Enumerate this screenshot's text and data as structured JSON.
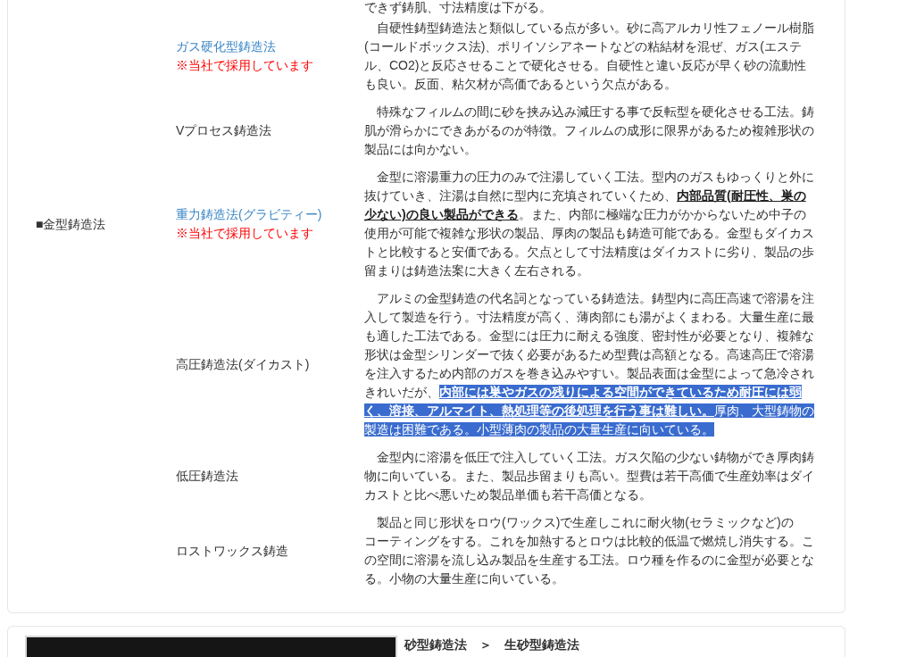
{
  "table": {
    "rows": [
      {
        "kind": "continuation",
        "description": [
          {
            "text": "できず鋳肌、寸法精度は下がる。",
            "selected": false
          }
        ]
      },
      {
        "kind": "method",
        "name": "ガス硬化型鋳造法",
        "linked": true,
        "note": "※当社で採用しています",
        "description": [
          {
            "text": "自硬性鋳型鋳造法と類似している点が多い。砂に高アルカリ性フェノール樹脂(コールドボックス法)、ポリイソシアネートなどの粘結材を混ぜ、ガス(エステル、CO2)と反応させることで硬化させる。自硬性と違い反応が早く砂の流動性も良い。反面、粘欠材が高価であるという欠点がある。",
            "selected": false
          }
        ]
      },
      {
        "kind": "method",
        "name": "Vプロセス鋳造法",
        "linked": false,
        "description": [
          {
            "text": "特殊なフィルムの間に砂を挟み込み減圧する事で反転型を硬化させる工法。鋳肌が滑らかにできあがるのが特徴。フィルムの成形に限界があるため複雑形状の製品には向かない。",
            "selected": false
          }
        ]
      },
      {
        "kind": "method",
        "category": "■金型鋳造法",
        "name": "重力鋳造法(グラビティー)",
        "linked": true,
        "note": "※当社で採用しています",
        "description": [
          {
            "text": "金型に溶湯重力の圧力のみで注湯していく工法。型内のガスもゆっくりと外に抜けていき、注湯は自然に型内に充填されていくため、**内部品質(耐圧性、巣の少ない)の良い製品ができる**。また、内部に極端な圧力がかからないため中子の使用が可能で複雑な形状の製品、厚肉の製品も鋳造可能である。金型もダイカストと比較すると安価である。欠点として寸法精度はダイカストに劣り、製品の歩留まりは鋳造法案に大きく左右される。",
            "selected": false
          }
        ]
      },
      {
        "kind": "method",
        "name": "高圧鋳造法(ダイカスト)",
        "linked": false,
        "description": [
          {
            "text": "アルミの金型鋳造の代名詞となっている鋳造法。鋳型内に高圧高速で溶湯を注入して製造を行う。寸法精度が高く、薄肉部にも湯がよくまわる。大量生産に最も適した工法である。金型には圧力に耐える強度、密封性が必要となり、複雑な形状は金型シリンダーで抜く必要があるため型費は高額となる。高速高圧で溶湯を注入するため内部のガスを巻き込みやすい。製品表面は金型によって急冷されきれいだが、",
            "selected": false
          },
          {
            "text": "**内部には巣やガスの残りによる空間ができているため耐圧には弱く、溶接、アルマイト、熱処理等の後処理を行う事は難しい。**厚肉、大型鋳物の製造は困難である。小型薄肉の製品の大量生産に向いている。",
            "selected": true
          }
        ]
      },
      {
        "kind": "method",
        "name": "低圧鋳造法",
        "linked": false,
        "description": [
          {
            "text": "金型内に溶湯を低圧で注入していく工法。ガス欠陥の少ない鋳物ができ厚肉鋳物に向いている。また、製品歩留まりも高い。型費は若干高価で生産効率はダイカストと比べ悪いため製品単価も若干高価となる。",
            "selected": false
          }
        ]
      },
      {
        "kind": "method",
        "name": "ロストワックス鋳造",
        "linked": false,
        "description": [
          {
            "text": "製品と同じ形状をロウ(ワックス)で生産しこれに耐火物(セラミックなど)のコーティングをする。これを加熱するとロウは比較的低温で燃焼し消失する。この空間に溶湯を流し込み製品を生産する工法。ロウ種を作るのに金型が必要となる。小物の大量生産に向いている。",
            "selected": false
          }
        ]
      }
    ]
  },
  "next_section": {
    "heading": "砂型鋳造法　＞　生砂型鋳造法"
  }
}
